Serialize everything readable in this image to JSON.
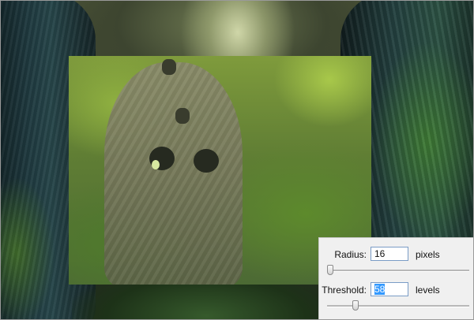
{
  "dialog": {
    "radius": {
      "label": "Radius:",
      "value": "16",
      "unit": "pixels",
      "slider_level": 0.02
    },
    "threshold": {
      "label": "Threshold:",
      "value": "58",
      "unit": "levels",
      "slider_level": 0.2
    }
  }
}
